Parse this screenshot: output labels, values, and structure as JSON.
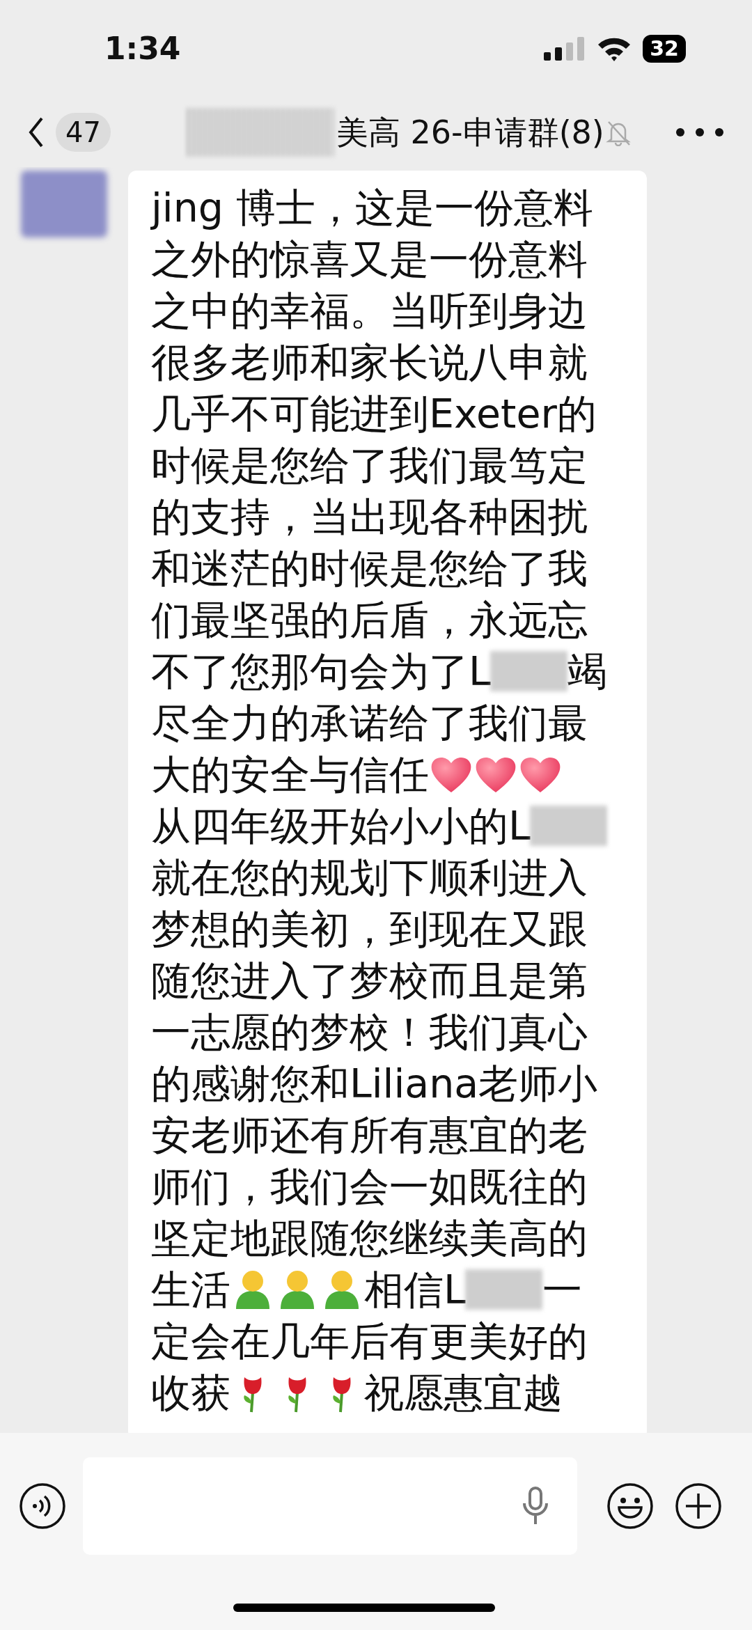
{
  "status_bar": {
    "time": "1:34",
    "battery": "32"
  },
  "header": {
    "back_count": "47",
    "title": "美高 26-申请群(8)",
    "muted": true
  },
  "messages": [
    {
      "avatar_redacted": true,
      "lines": [
        [
          {
            "kind": "text",
            "text": "jing 博士，这是一份意料"
          }
        ],
        [
          {
            "kind": "text",
            "text": "之外的惊喜又是一份意料"
          }
        ],
        [
          {
            "kind": "text",
            "text": "之中的幸福。当听到身边"
          }
        ],
        [
          {
            "kind": "text",
            "text": "很多老师和家长说八申就"
          }
        ],
        [
          {
            "kind": "text",
            "text": "几乎不可能进到Exeter的"
          }
        ],
        [
          {
            "kind": "text",
            "text": "时候是您给了我们最笃定"
          }
        ],
        [
          {
            "kind": "text",
            "text": "的支持，当出现各种困扰"
          }
        ],
        [
          {
            "kind": "text",
            "text": "和迷茫的时候是您给了我"
          }
        ],
        [
          {
            "kind": "text",
            "text": "们最坚强的后盾，永远忘"
          }
        ],
        [
          {
            "kind": "text",
            "text": "不了您那句会为了L"
          },
          {
            "kind": "redacted"
          },
          {
            "kind": "text",
            "text": "竭"
          }
        ],
        [
          {
            "kind": "text",
            "text": "尽全力的承诺给了我们最"
          }
        ],
        [
          {
            "kind": "text",
            "text": "大的安全与信任"
          },
          {
            "kind": "heart"
          },
          {
            "kind": "heart"
          },
          {
            "kind": "heart"
          }
        ],
        [
          {
            "kind": "text",
            "text": "从四年级开始小小的L"
          },
          {
            "kind": "redacted"
          }
        ],
        [
          {
            "kind": "text",
            "text": "就在您的规划下顺利进入"
          }
        ],
        [
          {
            "kind": "text",
            "text": "梦想的美初，到现在又跟"
          }
        ],
        [
          {
            "kind": "text",
            "text": "随您进入了梦校而且是第"
          }
        ],
        [
          {
            "kind": "text",
            "text": "一志愿的梦校！我们真心"
          }
        ],
        [
          {
            "kind": "text",
            "text": "的感谢您和Liliana老师小"
          }
        ],
        [
          {
            "kind": "text",
            "text": "安老师还有所有惠宜的老"
          }
        ],
        [
          {
            "kind": "text",
            "text": "师们，我们会一如既往的"
          }
        ],
        [
          {
            "kind": "text",
            "text": "坚定地跟随您继续美高的"
          }
        ],
        [
          {
            "kind": "text",
            "text": "生活"
          },
          {
            "kind": "person"
          },
          {
            "kind": "person"
          },
          {
            "kind": "person"
          },
          {
            "kind": "text",
            "text": "相信L"
          },
          {
            "kind": "redacted"
          },
          {
            "kind": "text",
            "text": "一"
          }
        ],
        [
          {
            "kind": "text",
            "text": "定会在几年后有更美好的"
          }
        ],
        [
          {
            "kind": "text",
            "text": "收获"
          },
          {
            "kind": "rose"
          },
          {
            "kind": "rose"
          },
          {
            "kind": "rose"
          },
          {
            "kind": "text",
            "text": "祝愿惠宜越"
          }
        ]
      ]
    }
  ]
}
